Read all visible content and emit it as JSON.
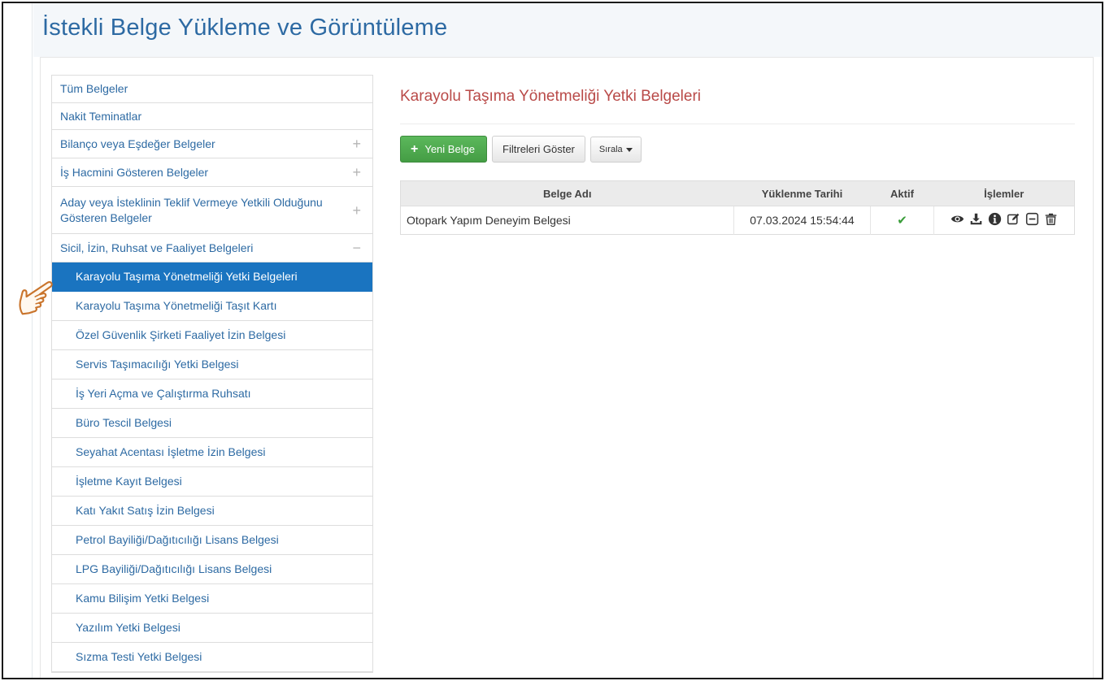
{
  "page": {
    "title": "İstekli Belge Yükleme ve Görüntüleme"
  },
  "sidebar": {
    "items": [
      {
        "label": "Tüm Belgeler",
        "expander": ""
      },
      {
        "label": "Nakit Teminatlar",
        "expander": ""
      },
      {
        "label": "Bilanço veya Eşdeğer Belgeler",
        "expander": "+"
      },
      {
        "label": "İş Hacmini Gösteren Belgeler",
        "expander": "+"
      },
      {
        "label": "Aday veya İsteklinin Teklif Vermeye Yetkili Olduğunu Gösteren Belgeler",
        "expander": "+"
      },
      {
        "label": "Sicil, İzin, Ruhsat ve Faaliyet Belgeleri",
        "expander": "−"
      }
    ],
    "subitems": [
      {
        "label": "Karayolu Taşıma Yönetmeliği Yetki Belgeleri"
      },
      {
        "label": "Karayolu Taşıma Yönetmeliği Taşıt Kartı"
      },
      {
        "label": "Özel Güvenlik Şirketi Faaliyet İzin Belgesi"
      },
      {
        "label": "Servis Taşımacılığı Yetki Belgesi"
      },
      {
        "label": "İş Yeri Açma ve Çalıştırma Ruhsatı"
      },
      {
        "label": "Büro Tescil Belgesi"
      },
      {
        "label": "Seyahat Acentası İşletme İzin Belgesi"
      },
      {
        "label": "İşletme Kayıt Belgesi"
      },
      {
        "label": "Katı Yakıt Satış İzin Belgesi"
      },
      {
        "label": "Petrol Bayiliği/Dağıtıcılığı Lisans Belgesi"
      },
      {
        "label": "LPG Bayiliği/Dağıtıcılığı Lisans Belgesi"
      },
      {
        "label": "Kamu Bilişim Yetki Belgesi"
      },
      {
        "label": "Yazılım Yetki Belgesi"
      },
      {
        "label": "Sızma Testi Yetki Belgesi"
      }
    ],
    "active_subitem": "Karayolu Taşıma Yönetmeliği Yetki Belgeleri"
  },
  "main": {
    "heading": "Karayolu Taşıma Yönetmeliği Yetki Belgeleri",
    "toolbar": {
      "new_label": "Yeni Belge",
      "filters_label": "Filtreleri Göster",
      "sort_label": "Sırala"
    },
    "table": {
      "headers": [
        "Belge Adı",
        "Yüklenme Tarihi",
        "Aktif",
        "İşlemler"
      ],
      "rows": [
        {
          "name": "Otopark Yapım Deneyim Belgesi",
          "date": "07.03.2024 15:54:44",
          "active": "✔"
        }
      ]
    },
    "row_action_icons": [
      "eye-icon",
      "download-icon",
      "info-icon",
      "edit-icon",
      "collapse-icon",
      "trash-icon"
    ]
  },
  "colors": {
    "link": "#2d6aa3",
    "active_bg": "#1a74c0",
    "heading_red": "#b94a48",
    "success": "#5cb85c",
    "hand_outline": "#c9742c"
  }
}
